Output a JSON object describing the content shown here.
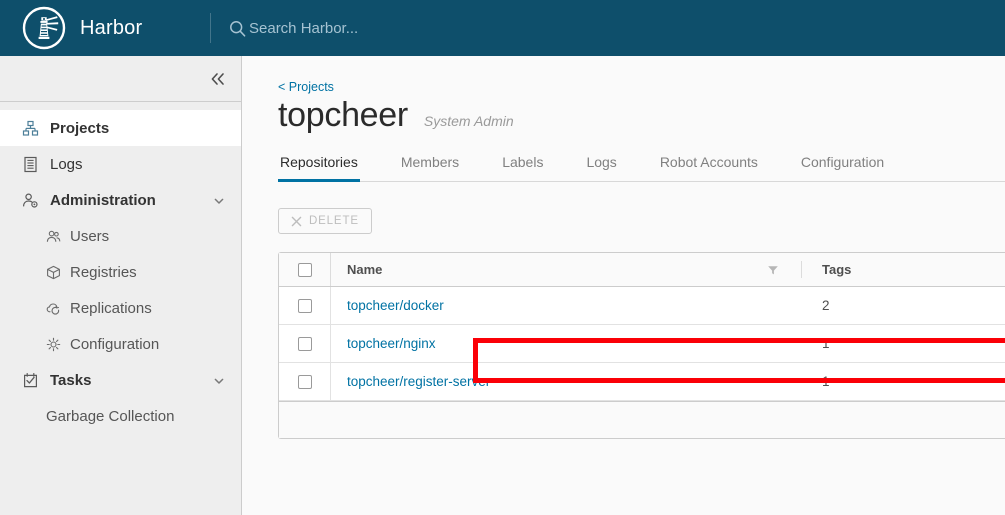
{
  "header": {
    "brand_name": "Harbor",
    "logo_icon": "harbor-lighthouse-logo",
    "search_icon": "search-icon",
    "search_placeholder": "Search Harbor...",
    "search_value": ""
  },
  "sidebar": {
    "collapse_icon": "double-chevron-left-icon",
    "items": [
      {
        "label": "Projects",
        "icon": "projects-icon",
        "level": "top",
        "active": true,
        "expandable": false
      },
      {
        "label": "Logs",
        "icon": "logs-icon",
        "level": "top",
        "active": false,
        "expandable": false
      },
      {
        "label": "Administration",
        "icon": "administration-user-gear-icon",
        "level": "top",
        "active": false,
        "expandable": true,
        "chevron": "chevron-down-icon"
      },
      {
        "label": "Users",
        "icon": "users-icon",
        "level": "sub",
        "active": false,
        "expandable": false
      },
      {
        "label": "Registries",
        "icon": "registries-cube-icon",
        "level": "sub",
        "active": false,
        "expandable": false
      },
      {
        "label": "Replications",
        "icon": "replications-cloud-sync-icon",
        "level": "sub",
        "active": false,
        "expandable": false
      },
      {
        "label": "Configuration",
        "icon": "configuration-gear-icon",
        "level": "sub",
        "active": false,
        "expandable": false
      },
      {
        "label": "Tasks",
        "icon": "tasks-checklist-icon",
        "level": "top",
        "active": false,
        "expandable": true,
        "chevron": "chevron-down-icon"
      },
      {
        "label": "Garbage Collection",
        "icon": "",
        "level": "sub",
        "active": false,
        "expandable": false
      }
    ]
  },
  "main": {
    "breadcrumb": "< Projects",
    "project_name": "topcheer",
    "role_badge": "System Admin",
    "tabs": [
      {
        "label": "Repositories",
        "active": true
      },
      {
        "label": "Members",
        "active": false
      },
      {
        "label": "Labels",
        "active": false
      },
      {
        "label": "Logs",
        "active": false
      },
      {
        "label": "Robot Accounts",
        "active": false
      },
      {
        "label": "Configuration",
        "active": false
      }
    ],
    "toolbar": {
      "delete_label": "DELETE",
      "delete_icon": "close-x-icon",
      "delete_disabled": true
    },
    "table": {
      "columns": [
        "Name",
        "Tags"
      ],
      "name_filter_icon": "filter-funnel-icon",
      "select_all_checked": false,
      "rows": [
        {
          "name": "topcheer/docker",
          "tags": "2",
          "checked": false,
          "highlighted": true
        },
        {
          "name": "topcheer/nginx",
          "tags": "1",
          "checked": false,
          "highlighted": false
        },
        {
          "name": "topcheer/register-server",
          "tags": "1",
          "checked": false,
          "highlighted": false
        }
      ]
    }
  },
  "annotation": {
    "color": "#fb0007",
    "target": "topcheer/docker"
  },
  "colors": {
    "header_bg": "#0e4f6b",
    "link": "#0072a3",
    "accent": "#0072a3",
    "sidebar_bg": "#eeeeee",
    "content_bg": "#fafafa",
    "annotation_red": "#fb0007"
  }
}
